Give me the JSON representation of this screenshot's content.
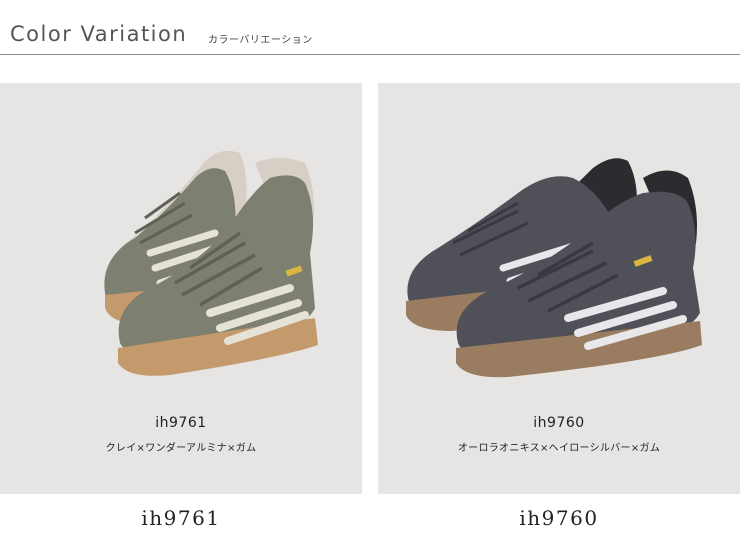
{
  "header": {
    "title": "Color Variation",
    "subtitle": "カラーバリエーション"
  },
  "products": [
    {
      "code": "ih9761",
      "color_name": "クレイ×ワンダーアルミナ×ガム",
      "caption": "ih9761",
      "colors": {
        "upper": "#7d7f70",
        "upper_dark": "#5f6154",
        "stripe": "#e6e2d8",
        "sole": "#c49a6c",
        "lining": "#d7cfc6"
      }
    },
    {
      "code": "ih9760",
      "color_name": "オーロラオニキス×ヘイローシルバー×ガム",
      "caption": "ih9760",
      "colors": {
        "upper": "#4f5058",
        "upper_dark": "#393a41",
        "stripe": "#e8e8ea",
        "sole": "#9a7c60",
        "lining": "#2c2c30"
      }
    }
  ]
}
